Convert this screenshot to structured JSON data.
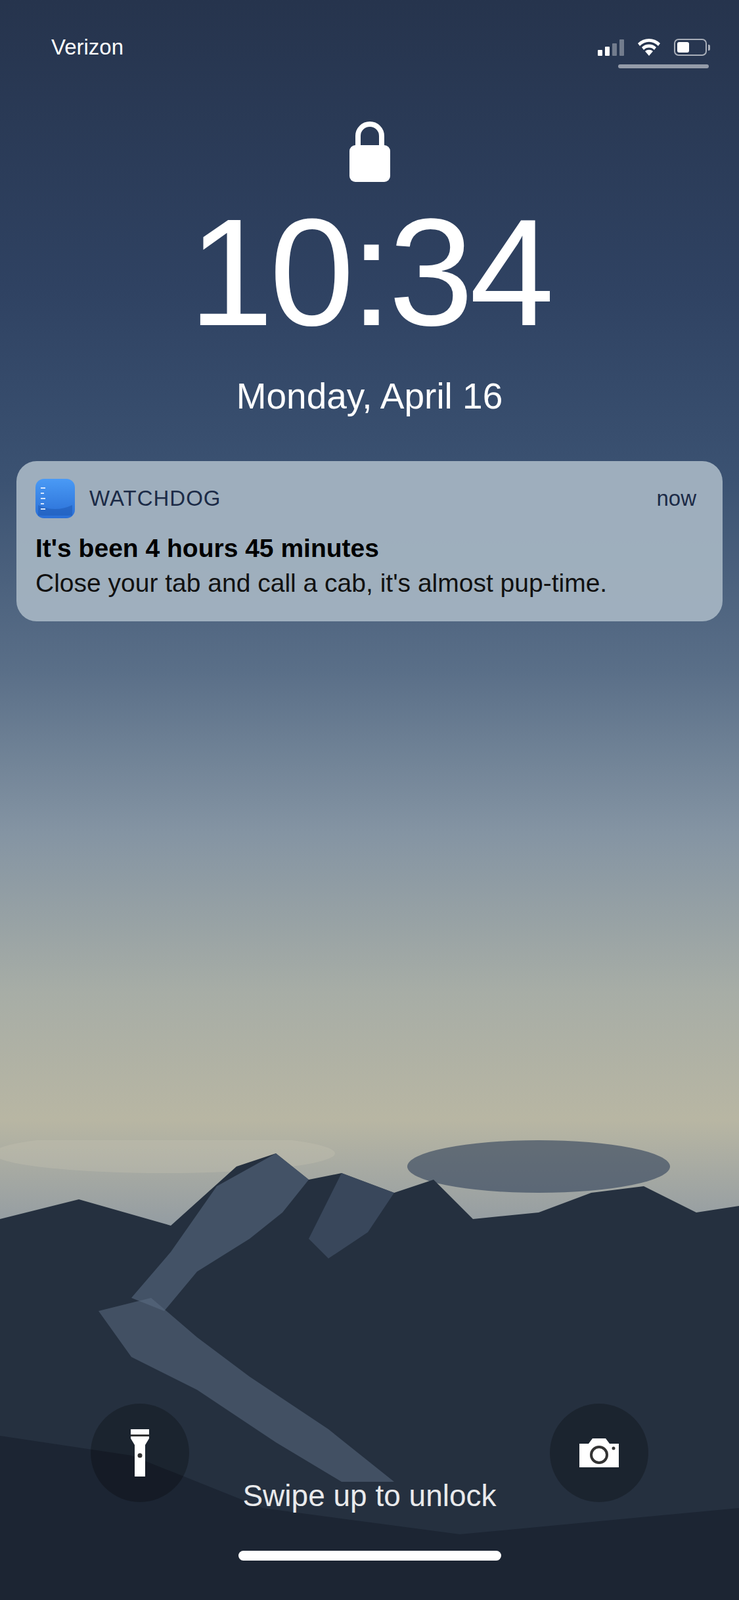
{
  "status_bar": {
    "carrier": "Verizon",
    "signal": {
      "level": 0.5
    },
    "battery": {
      "level": 0.45
    }
  },
  "lock_screen": {
    "time": "10:34",
    "date": "Monday, April 16"
  },
  "notifications": [
    {
      "app": "WATCHDOG",
      "time": "now",
      "title": "It's been 4 hours 45 minutes",
      "body": "Close your tab and call a cab, it's almost pup-time."
    }
  ],
  "footer": {
    "hint": "Swipe up to unlock"
  }
}
